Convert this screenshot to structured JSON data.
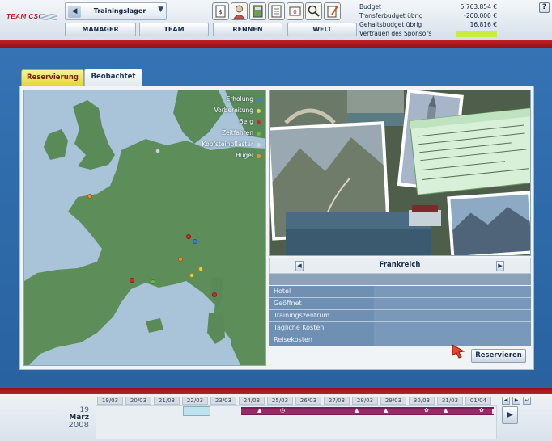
{
  "team_logo": "TEAM CSC",
  "camp_select": {
    "label": "Trainingslager",
    "prev_icon": "◀",
    "arrow_icon": "▼"
  },
  "nav": [
    "MANAGER",
    "TEAM",
    "RENNEN",
    "WELT"
  ],
  "tools": [
    "contract-icon",
    "manager-icon",
    "book-icon",
    "document-icon",
    "message-icon",
    "search-icon",
    "edit-icon"
  ],
  "budget": {
    "rows": [
      {
        "label": "Budget",
        "value": "5.763.854 €"
      },
      {
        "label": "Transferbudget übrig",
        "value": "-200.000 €"
      },
      {
        "label": "Gehaltsbudget übrig",
        "value": "16.816 €"
      },
      {
        "label": "Vertrauen des Sponsors",
        "value": ""
      }
    ],
    "sponsor_color": "#c8ec44"
  },
  "help": "?",
  "tabs": {
    "active": "Reservierung",
    "other": "Beobachtet"
  },
  "legend": [
    {
      "label": "Erholung",
      "color": "#3a7fe0"
    },
    {
      "label": "Vorbereitung",
      "color": "#e8d23a"
    },
    {
      "label": "Berg",
      "color": "#d6262c"
    },
    {
      "label": "Zeitfahren",
      "color": "#62c23a"
    },
    {
      "label": "Kopfsteinpflaster",
      "color": "#cfd6dd"
    },
    {
      "label": "Hügel",
      "color": "#f0902a"
    }
  ],
  "country": {
    "name": "Frankreich",
    "prev": "◀",
    "next": "▶"
  },
  "info": [
    {
      "label": "Hotel",
      "value": ""
    },
    {
      "label": "Geöffnet",
      "value": ""
    },
    {
      "label": "Trainingszentrum",
      "value": ""
    },
    {
      "label": "Tägliche Kosten",
      "value": ""
    },
    {
      "label": "Reisekosten",
      "value": ""
    }
  ],
  "reserve_label": "Reservieren",
  "date": {
    "day": "19",
    "month": "März",
    "year": "2008"
  },
  "calendar_days": [
    "19/03",
    "20/03",
    "21/03",
    "22/03",
    "23/03",
    "24/03",
    "25/03",
    "26/03",
    "27/03",
    "28/03",
    "29/03",
    "30/03",
    "31/03",
    "01/04"
  ],
  "calendar_nav": {
    "prev": "◀",
    "next": "▶",
    "return": "↵",
    "go": "▶"
  }
}
